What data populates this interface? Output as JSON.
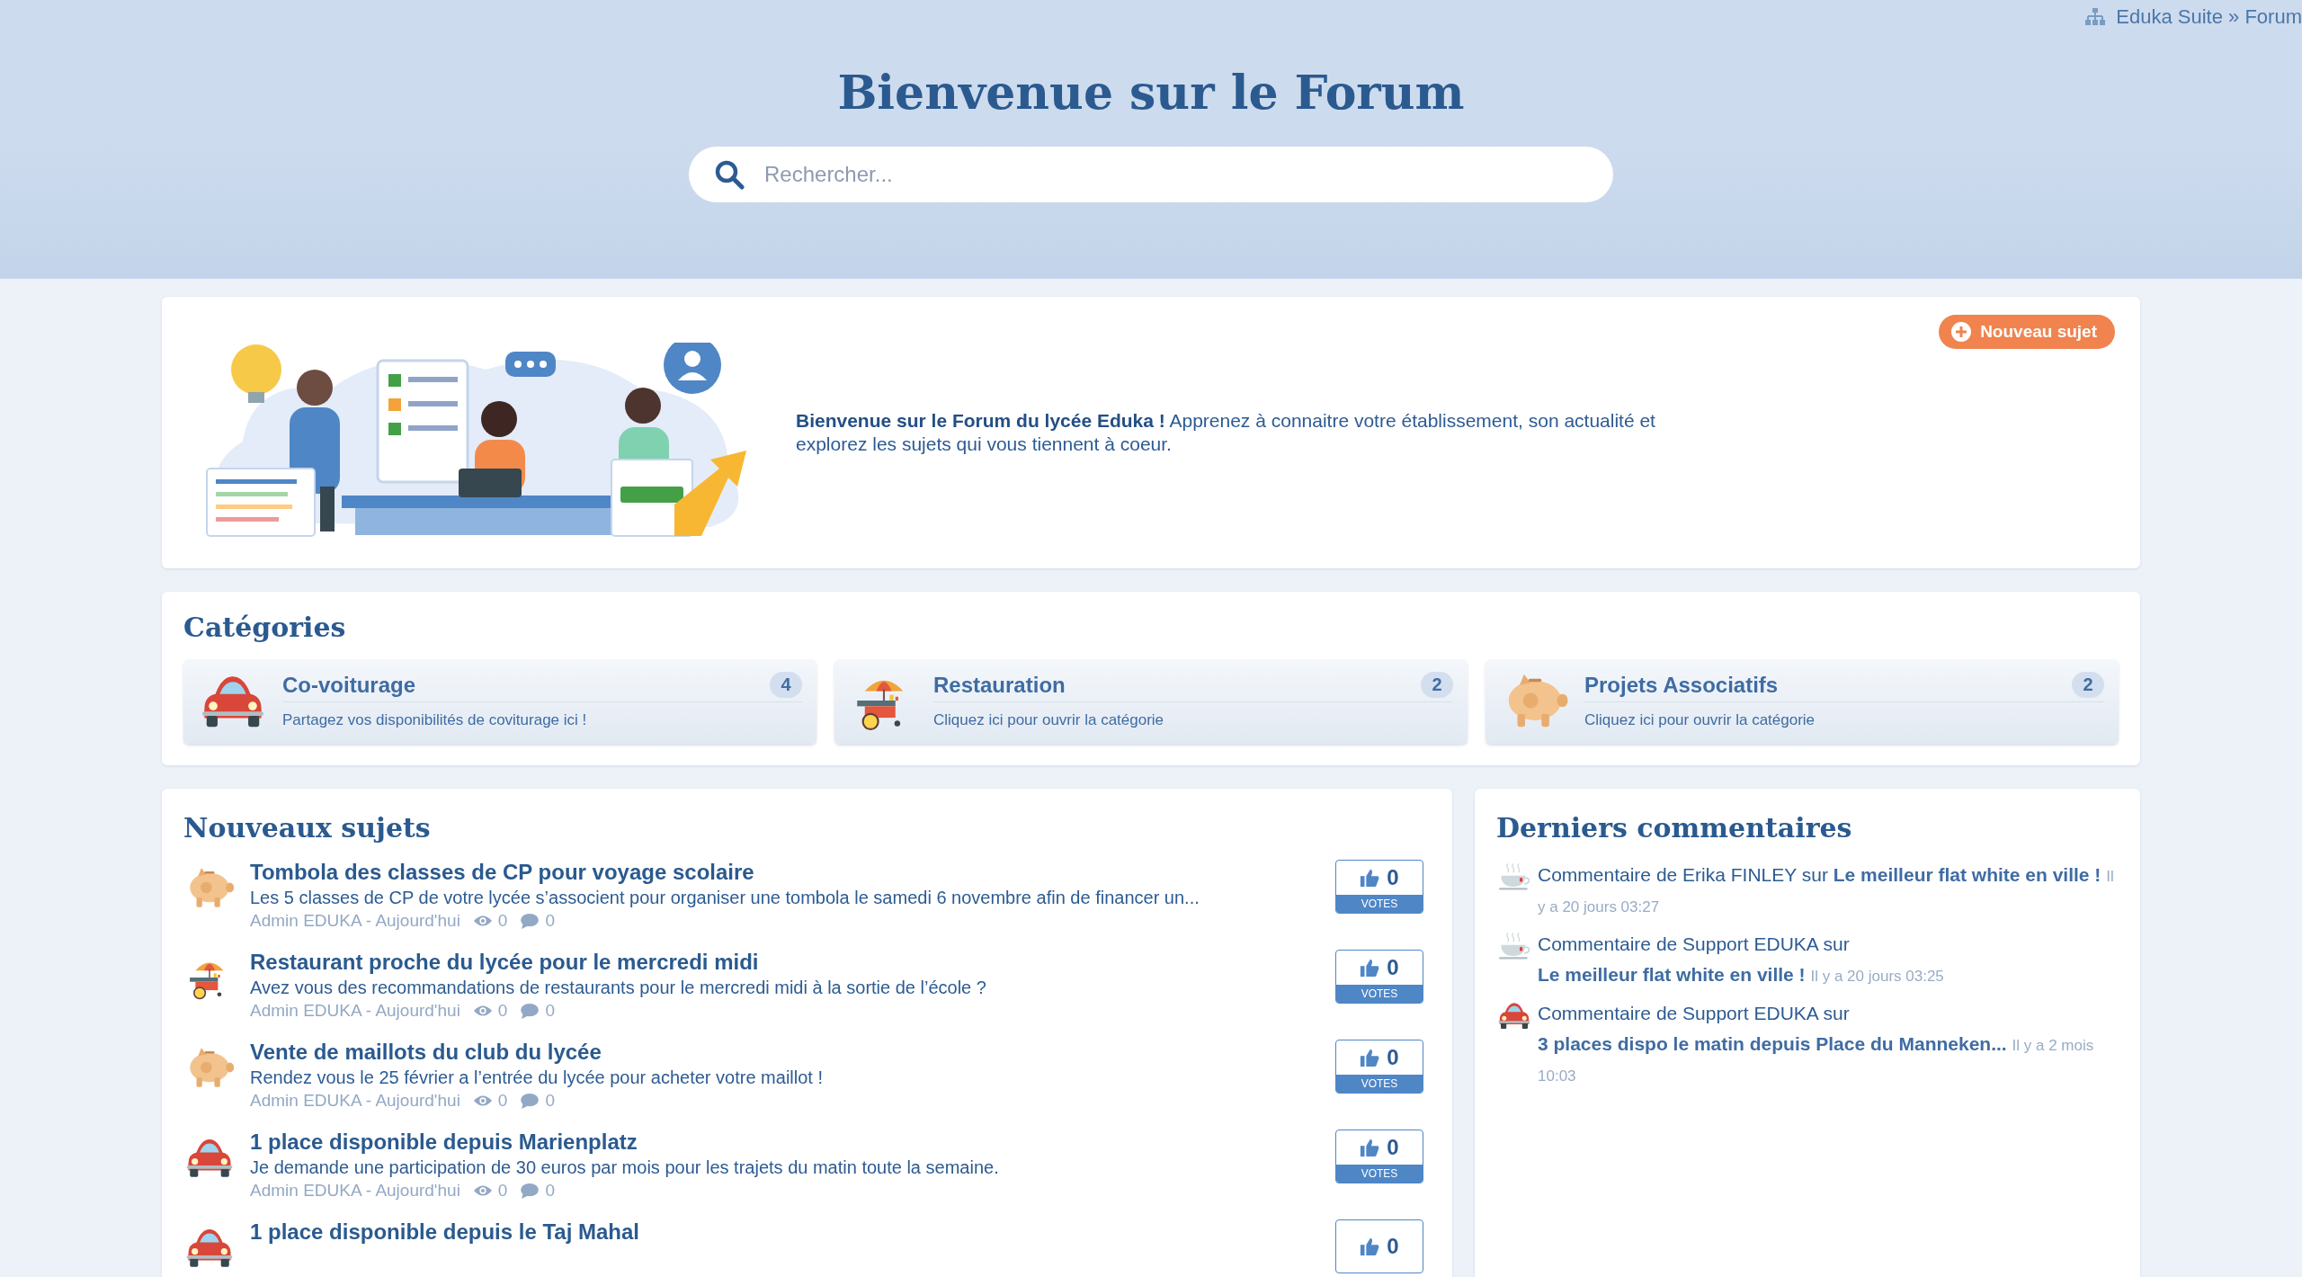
{
  "breadcrumb": "Eduka Suite » Forum",
  "title": "Bienvenue sur le Forum",
  "search": {
    "placeholder": "Rechercher..."
  },
  "welcome": {
    "text": "**Bienvenue sur le Forum du lycée Eduka !** Apprenez à connaitre votre établissement, son actualité et explorez les sujets qui vous tiennent à coeur.",
    "button": "Nouveau sujet"
  },
  "categories": {
    "title": "Catégories",
    "items": [
      {
        "kind": "car",
        "name": "Co-voiturage",
        "description": "Partagez vos disponibilités de coviturage ici !",
        "count": "4"
      },
      {
        "kind": "cart",
        "name": "Restauration",
        "description": "Cliquez ici pour ouvrir la catégorie",
        "count": "2"
      },
      {
        "kind": "piggy",
        "name": "Projets Associatifs",
        "description": "Cliquez ici pour ouvrir la catégorie",
        "count": "2"
      }
    ]
  },
  "topics": {
    "title": "Nouveaux sujets",
    "items": [
      {
        "kind": "piggy",
        "title": "Tombola des classes de CP pour voyage scolaire",
        "excerpt": "Les 5 classes de CP de votre lycée s’associent pour organiser une tombola le samedi 6 novembre afin de financer un...",
        "meta": "Admin EDUKA - Aujourd'hui",
        "views": "0",
        "comments": "0",
        "votes": "0",
        "votes_label": "VOTES"
      },
      {
        "kind": "cart",
        "title": "Restaurant proche du lycée pour le mercredi midi",
        "excerpt": "Avez vous des recommandations de restaurants pour le mercredi midi à la sortie de l’école ?",
        "meta": "Admin EDUKA - Aujourd'hui",
        "views": "0",
        "comments": "0",
        "votes": "0",
        "votes_label": "VOTES"
      },
      {
        "kind": "piggy",
        "title": "Vente de maillots du club du lycée",
        "excerpt": "Rendez vous le 25 février a l’entrée du lycée pour acheter votre maillot !",
        "meta": "Admin EDUKA - Aujourd'hui",
        "views": "0",
        "comments": "0",
        "votes": "0",
        "votes_label": "VOTES"
      },
      {
        "kind": "car",
        "title": "1 place disponible depuis Marienplatz",
        "excerpt": "Je demande une participation de 30 euros par mois pour les trajets du matin toute la semaine.",
        "meta": "Admin EDUKA - Aujourd'hui",
        "views": "0",
        "comments": "0",
        "votes": "0",
        "votes_label": "VOTES"
      },
      {
        "kind": "car",
        "title": "1 place disponible depuis le Taj Mahal",
        "votes": "0"
      }
    ]
  },
  "comments": {
    "title": "Derniers commentaires",
    "items": [
      {
        "kind": "cup",
        "text": "Commentaire de Erika FINLEY sur",
        "link": "Le meilleur flat white en ville !",
        "time": "Il y a 20 jours 03:27"
      },
      {
        "kind": "cup",
        "text": "Commentaire de Support EDUKA sur",
        "link": "Le meilleur flat white en ville !",
        "time": "Il y a 20 jours 03:25"
      },
      {
        "kind": "car",
        "text": "Commentaire de Support EDUKA sur",
        "link": "3 places dispo le matin depuis Place du Manneken...",
        "time": "Il y a 2 mois 10:03"
      }
    ]
  }
}
